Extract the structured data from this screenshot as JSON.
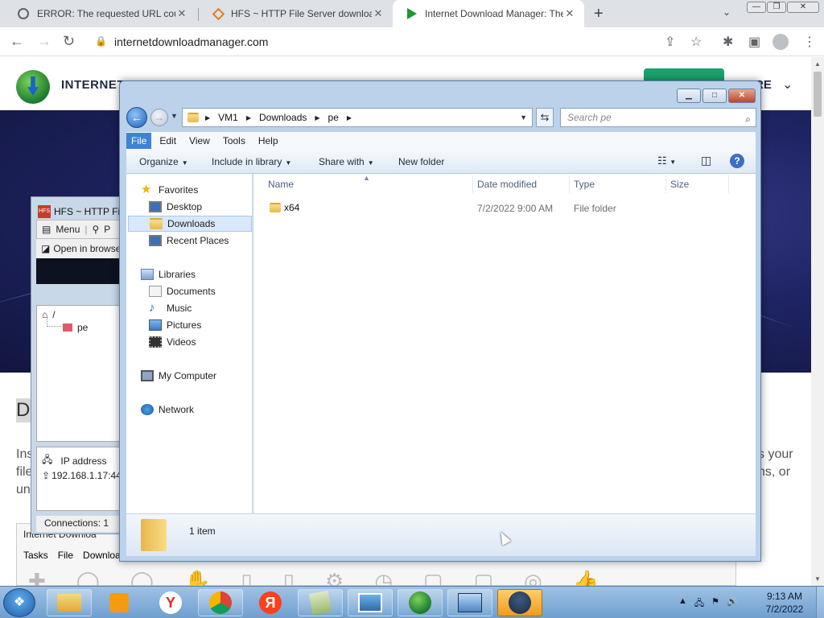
{
  "browser": {
    "tabs": [
      {
        "title": "ERROR: The requested URL could",
        "active": false
      },
      {
        "title": "HFS ~ HTTP File Server downloa",
        "active": false
      },
      {
        "title": "Internet Download Manager: The",
        "active": true
      }
    ],
    "close_glyph": "✕",
    "new_tab_glyph": "+",
    "tab_search_glyph": "⌄",
    "window_controls": {
      "minimize": "—",
      "restore": "❐",
      "close": "✕"
    },
    "url": "internetdownloadmanager.com"
  },
  "page": {
    "site_name": "INTERNET",
    "site_nav_fragment": "RE",
    "heading_fragment": "D",
    "text_left": [
      "Ins",
      "file",
      "un"
    ],
    "text_right": [
      "s your",
      "ns, or"
    ],
    "idm_app": {
      "title": "Internet Downloa",
      "menu": [
        "Tasks",
        "File",
        "Downloa"
      ]
    }
  },
  "hfs": {
    "title": "HFS ~ HTTP Fil",
    "menu_label": "Menu",
    "p_label": "P",
    "open_in_browser": "Open in browse",
    "tree_root": "/",
    "tree_child": "pe",
    "ip_header": "IP address",
    "ip_value": "192.168.1.17:44",
    "connections": "Connections: 1"
  },
  "explorer": {
    "address_segments": [
      "VM1",
      "Downloads",
      "pe"
    ],
    "search_placeholder": "Search pe",
    "menu": [
      "File",
      "Edit",
      "View",
      "Tools",
      "Help"
    ],
    "commands": {
      "organize": "Organize",
      "include_in_library": "Include in library",
      "share_with": "Share with",
      "new_folder": "New folder"
    },
    "nav": {
      "favorites": "Favorites",
      "desktop": "Desktop",
      "downloads": "Downloads",
      "recent_places": "Recent Places",
      "libraries": "Libraries",
      "documents": "Documents",
      "music": "Music",
      "pictures": "Pictures",
      "videos": "Videos",
      "my_computer": "My Computer",
      "network": "Network"
    },
    "columns": {
      "name": "Name",
      "date_modified": "Date modified",
      "type": "Type",
      "size": "Size"
    },
    "files": [
      {
        "name": "x64",
        "date_modified": "7/2/2022 9:00 AM",
        "type": "File folder",
        "size": ""
      }
    ],
    "status": "1 item"
  },
  "taskbar": {
    "clock_time": "9:13 AM",
    "clock_date": "7/2/2022",
    "yandex_browser_glyph": "Y",
    "yandex_glyph": "Я"
  }
}
